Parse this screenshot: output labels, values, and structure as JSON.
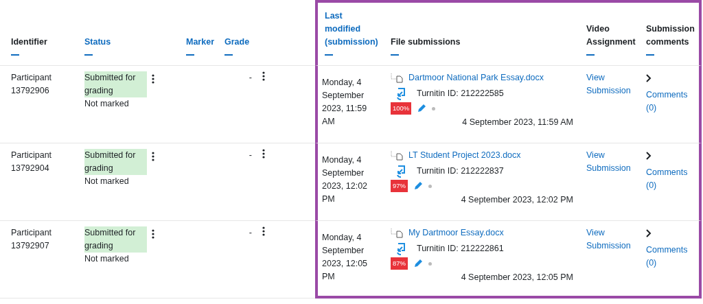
{
  "columns": [
    {
      "label": "Identifier",
      "link": false
    },
    {
      "label": "Status",
      "link": true
    },
    {
      "label": "Marker",
      "link": true
    },
    {
      "label": "Grade",
      "link": true
    },
    {
      "label": "Last modified (submission)",
      "link": true
    },
    {
      "label": "File submissions",
      "link": false
    },
    {
      "label": "Video Assignment",
      "link": false
    },
    {
      "label": "Submission comments",
      "link": false
    }
  ],
  "rows": [
    {
      "identifier": "Participant 13792906",
      "status": "Submitted for grading",
      "marking": "Not marked",
      "grade": "-",
      "modified": "Monday, 4 September 2023, 11:59 AM",
      "file": {
        "name": "Dartmoor National Park Essay.docx",
        "turnitin": "Turnitin ID: 212222585",
        "similarity": "100%",
        "date": "4 September 2023, 11:59 AM"
      },
      "video": "View Submission",
      "comments": "Comments (0)"
    },
    {
      "identifier": "Participant 13792904",
      "status": "Submitted for grading",
      "marking": "Not marked",
      "grade": "-",
      "modified": "Monday, 4 September 2023, 12:02 PM",
      "file": {
        "name": "LT Student Project 2023.docx",
        "turnitin": "Turnitin ID: 212222837",
        "similarity": "97%",
        "date": "4 September 2023, 12:02 PM"
      },
      "video": "View Submission",
      "comments": "Comments (0)"
    },
    {
      "identifier": "Participant 13792907",
      "status": "Submitted for grading",
      "marking": "Not marked",
      "grade": "-",
      "modified": "Monday, 4 September 2023, 12:05 PM",
      "file": {
        "name": "My Dartmoor Essay.docx",
        "turnitin": "Turnitin ID: 212222861",
        "similarity": "87%",
        "date": "4 September 2023, 12:05 PM"
      },
      "video": "View Submission",
      "comments": "Comments (0)"
    }
  ]
}
